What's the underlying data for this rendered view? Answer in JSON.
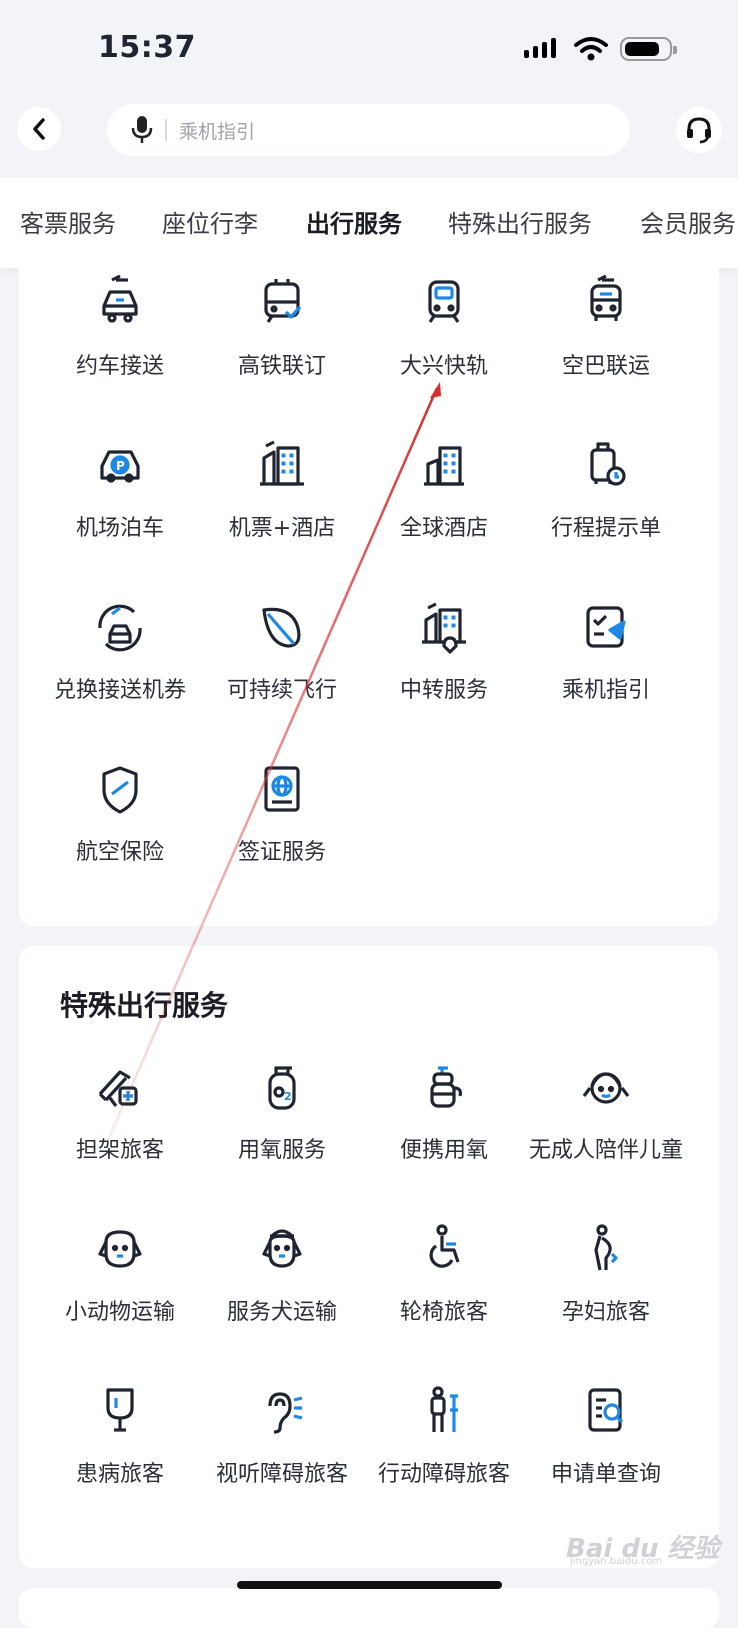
{
  "status_bar": {
    "time": "15:37"
  },
  "search": {
    "placeholder": "乘机指引"
  },
  "tabs": [
    {
      "label": "客票服务",
      "active": false
    },
    {
      "label": "座位行李",
      "active": false
    },
    {
      "label": "出行服务",
      "active": true
    },
    {
      "label": "特殊出行服务",
      "active": false
    },
    {
      "label": "会员服务",
      "active": false
    }
  ],
  "travel_services": {
    "items": [
      {
        "label": "约车接送",
        "icon": "taxi-icon"
      },
      {
        "label": "高铁联订",
        "icon": "train-check-icon"
      },
      {
        "label": "大兴快轨",
        "icon": "metro-icon"
      },
      {
        "label": "空巴联运",
        "icon": "airport-bus-icon"
      },
      {
        "label": "机场泊车",
        "icon": "parking-car-icon"
      },
      {
        "label": "机票+酒店",
        "icon": "flight-hotel-icon"
      },
      {
        "label": "全球酒店",
        "icon": "hotel-icon"
      },
      {
        "label": "行程提示单",
        "icon": "itinerary-luggage-icon"
      },
      {
        "label": "兑换接送机券",
        "icon": "voucher-exchange-icon"
      },
      {
        "label": "可持续飞行",
        "icon": "leaf-icon"
      },
      {
        "label": "中转服务",
        "icon": "transfer-icon"
      },
      {
        "label": "乘机指引",
        "icon": "boarding-guide-icon"
      },
      {
        "label": "航空保险",
        "icon": "shield-plane-icon"
      },
      {
        "label": "签证服务",
        "icon": "passport-icon"
      }
    ]
  },
  "special_services": {
    "title": "特殊出行服务",
    "items": [
      {
        "label": "担架旅客",
        "icon": "stretcher-icon"
      },
      {
        "label": "用氧服务",
        "icon": "oxygen-tank-icon"
      },
      {
        "label": "便携用氧",
        "icon": "portable-oxygen-icon"
      },
      {
        "label": "无成人陪伴儿童",
        "icon": "child-icon"
      },
      {
        "label": "小动物运输",
        "icon": "pet-icon"
      },
      {
        "label": "服务犬运输",
        "icon": "service-dog-icon"
      },
      {
        "label": "轮椅旅客",
        "icon": "wheelchair-icon"
      },
      {
        "label": "孕妇旅客",
        "icon": "pregnant-icon"
      },
      {
        "label": "患病旅客",
        "icon": "iv-drip-icon"
      },
      {
        "label": "视听障碍旅客",
        "icon": "hearing-icon"
      },
      {
        "label": "行动障碍旅客",
        "icon": "crutch-icon"
      },
      {
        "label": "申请单查询",
        "icon": "document-search-icon"
      }
    ]
  },
  "watermark": {
    "logo": "Bai du 经验",
    "sub": "jingyan.baidu.com"
  },
  "colors": {
    "accent": "#c8102e",
    "icon_dark": "#1f2430",
    "icon_blue": "#1e88e5"
  }
}
